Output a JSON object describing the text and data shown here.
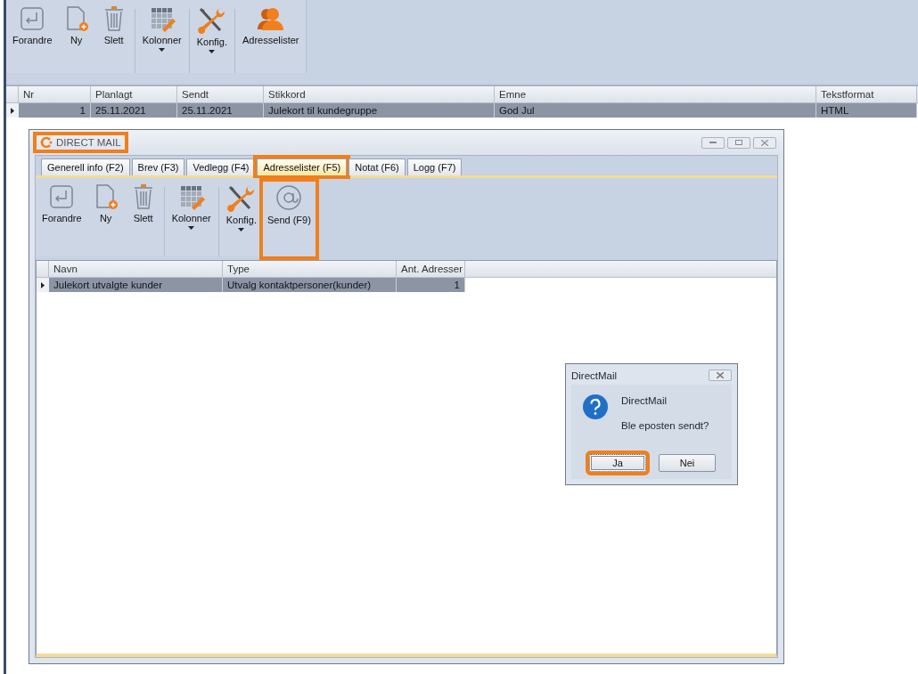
{
  "toolbar": {
    "groups": [
      [
        {
          "kind": "edit",
          "label": "Forandre",
          "dropdown": false
        },
        {
          "kind": "new",
          "label": "Ny",
          "dropdown": false
        },
        {
          "kind": "delete",
          "label": "Slett",
          "dropdown": false
        }
      ],
      [
        {
          "kind": "columns",
          "label": "Kolonner",
          "dropdown": true
        }
      ],
      [
        {
          "kind": "config",
          "label": "Konfig.",
          "dropdown": true
        }
      ],
      [
        {
          "kind": "contacts",
          "label": "Adresselister",
          "dropdown": false
        }
      ]
    ]
  },
  "table": {
    "columns": [
      {
        "label": "Nr",
        "kind": "number"
      },
      {
        "label": "Planlagt",
        "kind": "text"
      },
      {
        "label": "Sendt",
        "kind": "text"
      },
      {
        "label": "Stikkord",
        "kind": "text"
      },
      {
        "label": "Emne",
        "kind": "text"
      },
      {
        "label": "Tekstformat",
        "kind": "text"
      }
    ],
    "rows": [
      {
        "selected": true,
        "cells": [
          "1",
          "25.11.2021",
          "25.11.2021",
          "Julekort til kundegruppe",
          "God Jul",
          "HTML"
        ]
      }
    ]
  },
  "window": {
    "title": "DIRECT MAIL",
    "highlighted": true,
    "tabs": [
      {
        "label": "Generell info (F2)",
        "selected": false,
        "highlighted": false
      },
      {
        "label": "Brev (F3)",
        "selected": false,
        "highlighted": false
      },
      {
        "label": "Vedlegg (F4)",
        "selected": false,
        "highlighted": false
      },
      {
        "label": "Adresselister (F5)",
        "selected": true,
        "highlighted": true
      },
      {
        "label": "Notat (F6)",
        "selected": false,
        "highlighted": false
      },
      {
        "label": "Logg (F7)",
        "selected": false,
        "highlighted": false
      }
    ],
    "toolbar": {
      "groups": [
        [
          {
            "kind": "edit",
            "label": "Forandre",
            "dropdown": false,
            "highlighted": false
          },
          {
            "kind": "new",
            "label": "Ny",
            "dropdown": false,
            "highlighted": false
          },
          {
            "kind": "delete",
            "label": "Slett",
            "dropdown": false,
            "highlighted": false
          }
        ],
        [
          {
            "kind": "columns",
            "label": "Kolonner",
            "dropdown": true,
            "highlighted": false
          }
        ],
        [
          {
            "kind": "config",
            "label": "Konfig.",
            "dropdown": true,
            "highlighted": false
          },
          {
            "kind": "send",
            "label": "Send (F9)",
            "dropdown": false,
            "highlighted": true
          }
        ]
      ]
    },
    "table": {
      "columns": [
        {
          "label": "Navn",
          "kind": "text"
        },
        {
          "label": "Type",
          "kind": "text"
        },
        {
          "label": "Ant. Adresser",
          "kind": "number"
        }
      ],
      "rows": [
        {
          "selected": true,
          "cells": [
            "Julekort utvalgte kunder",
            "Utvalg kontaktpersoner(kunder)",
            "1"
          ]
        }
      ]
    }
  },
  "dialog": {
    "title": "DirectMail",
    "heading": "DirectMail",
    "message": "Ble eposten sendt?",
    "buttons": [
      {
        "label": "Ja",
        "focused": true,
        "highlighted": true
      },
      {
        "label": "Nei",
        "focused": false,
        "highlighted": false
      }
    ]
  }
}
